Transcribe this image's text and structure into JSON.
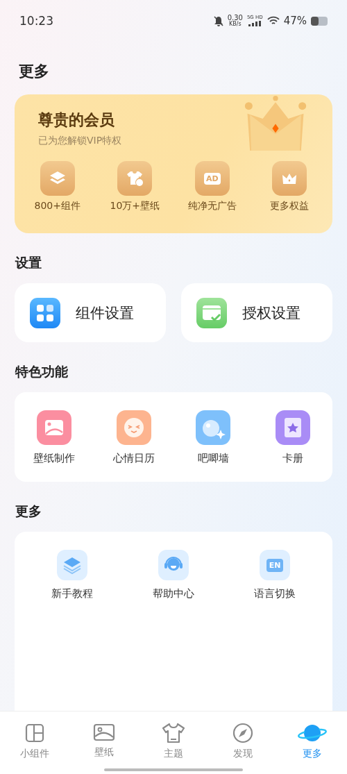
{
  "status_bar": {
    "time": "10:23",
    "speed": "0.30",
    "speed_unit": "KB/s",
    "network": "5G HD",
    "battery": "47%"
  },
  "page_title": "更多",
  "vip_card": {
    "title": "尊贵的会员",
    "subtitle": "已为您解锁VIP特权",
    "perks": [
      {
        "label": "800+组件"
      },
      {
        "label": "10万+壁纸"
      },
      {
        "label": "纯净无广告",
        "icon_text": "AD"
      },
      {
        "label": "更多权益"
      }
    ]
  },
  "settings": {
    "title": "设置",
    "items": [
      {
        "label": "组件设置"
      },
      {
        "label": "授权设置"
      }
    ]
  },
  "features": {
    "title": "特色功能",
    "items": [
      {
        "label": "壁纸制作"
      },
      {
        "label": "心情日历"
      },
      {
        "label": "吧唧墙"
      },
      {
        "label": "卡册"
      }
    ]
  },
  "more": {
    "title": "更多",
    "items": [
      {
        "label": "新手教程"
      },
      {
        "label": "帮助中心"
      },
      {
        "label": "语言切换",
        "icon_text": "EN"
      }
    ]
  },
  "tab_bar": [
    {
      "label": "小组件",
      "selected": false
    },
    {
      "label": "壁纸",
      "selected": false
    },
    {
      "label": "主题",
      "selected": false
    },
    {
      "label": "发现",
      "selected": false
    },
    {
      "label": "更多",
      "selected": true
    }
  ]
}
